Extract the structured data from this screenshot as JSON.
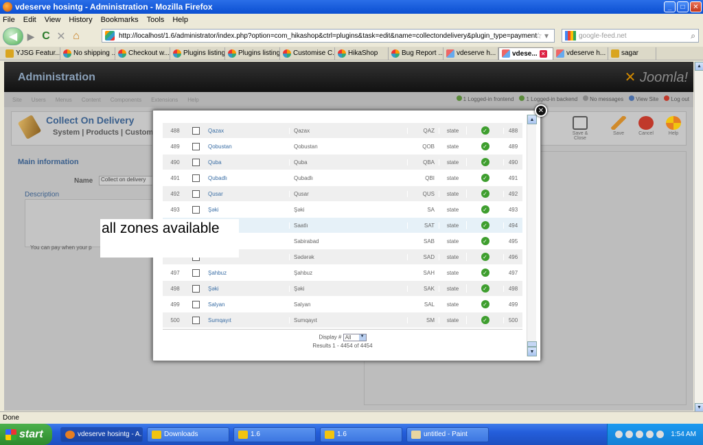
{
  "window": {
    "title": "vdeserve hosintg - Administration - Mozilla Firefox",
    "min": "_",
    "max": "□",
    "close": "✕"
  },
  "menubar": [
    "File",
    "Edit",
    "View",
    "History",
    "Bookmarks",
    "Tools",
    "Help"
  ],
  "nav": {
    "back": "◀",
    "forward": "▶",
    "reload": "C",
    "stop": "✕",
    "home": "⌂",
    "url": "http://localhost/1.6/administrator/index.php?option=com_hikashop&ctrl=plugins&task=edit&name=collectondelivery&plugin_type=payment",
    "star": "☆ ▾",
    "search_placeholder": "google-feed.net",
    "search_icon": "⌕"
  },
  "tabs": [
    {
      "label": "YJSG Featur...",
      "icon": "plain"
    },
    {
      "label": "No shipping ...",
      "icon": "joomla"
    },
    {
      "label": "Checkout w...",
      "icon": "joomla"
    },
    {
      "label": "Plugins listing",
      "icon": "joomla"
    },
    {
      "label": "Plugins listing",
      "icon": "joomla"
    },
    {
      "label": "Customise C...",
      "icon": "joomla"
    },
    {
      "label": "HikaShop",
      "icon": "joomla"
    },
    {
      "label": "Bug Report ...",
      "icon": "joomla"
    },
    {
      "label": "vdeserve h...",
      "icon": "x"
    },
    {
      "label": "vdese...",
      "icon": "x",
      "active": true
    },
    {
      "label": "vdeserve h...",
      "icon": "x"
    },
    {
      "label": "sagar",
      "icon": "plain"
    }
  ],
  "admin": {
    "title": "Administration",
    "logo": "Joomla!",
    "menu": [
      "Site",
      "Users",
      "Menus",
      "Content",
      "Components",
      "Extensions",
      "Help"
    ],
    "status": [
      "1 Logged-in frontend",
      "1 Logged-in backend",
      "No messages",
      "View Site",
      "Log out"
    ],
    "page_title": "Collect On Delivery",
    "subnav": "System | Products | Customers",
    "toolbar": [
      "Save & Close",
      "Save",
      "Cancel",
      "Help"
    ],
    "main_info": "Main information",
    "name_label": "Name",
    "name_value": "Collect on delivery",
    "description_label": "Description",
    "editor_text": "You can pay when your p"
  },
  "zones": [
    {
      "num": "488",
      "name": "Qazax",
      "name2": "Qazax",
      "code": "QAZ",
      "type": "state",
      "id": "488"
    },
    {
      "num": "489",
      "name": "Qobustan",
      "name2": "Qobustan",
      "code": "QOB",
      "type": "state",
      "id": "489"
    },
    {
      "num": "490",
      "name": "Quba",
      "name2": "Quba",
      "code": "QBA",
      "type": "state",
      "id": "490"
    },
    {
      "num": "491",
      "name": "Qubadlı",
      "name2": "Qubadlı",
      "code": "QBI",
      "type": "state",
      "id": "491"
    },
    {
      "num": "492",
      "name": "Qusar",
      "name2": "Qusar",
      "code": "QUS",
      "type": "state",
      "id": "492"
    },
    {
      "num": "493",
      "name": "Şəki",
      "name2": "Şəki",
      "code": "SA",
      "type": "state",
      "id": "493"
    },
    {
      "num": "",
      "name": "",
      "name2": "Saatlı",
      "code": "SAT",
      "type": "state",
      "id": "494"
    },
    {
      "num": "",
      "name": "",
      "name2": "Sabirabad",
      "code": "SAB",
      "type": "state",
      "id": "495"
    },
    {
      "num": "",
      "name": "",
      "name2": "Sədərək",
      "code": "SAD",
      "type": "state",
      "id": "496"
    },
    {
      "num": "497",
      "name": "Şahbuz",
      "name2": "Şahbuz",
      "code": "SAH",
      "type": "state",
      "id": "497"
    },
    {
      "num": "498",
      "name": "Şəki",
      "name2": "Şəki",
      "code": "SAK",
      "type": "state",
      "id": "498"
    },
    {
      "num": "499",
      "name": "Salyan",
      "name2": "Salyan",
      "code": "SAL",
      "type": "state",
      "id": "499"
    },
    {
      "num": "500",
      "name": "Sumqayıt",
      "name2": "Sumqayıt",
      "code": "SM",
      "type": "state",
      "id": "500"
    }
  ],
  "modal": {
    "close": "✕",
    "display_label": "Display #",
    "display_value": "All",
    "results": "Results 1 - 4454 of 4454"
  },
  "annotation": "all zones available",
  "statusbar": "Done",
  "taskbar": {
    "start": "start",
    "tasks": [
      "vdeserve hosintg - A...",
      "Downloads",
      "1.6",
      "1.6",
      "untitled - Paint"
    ],
    "clock": "1:54 AM"
  },
  "colors": {
    "accent": "#3a6ea5",
    "publish_green": "#3e9e2e",
    "taskbar_blue": "#245edb"
  }
}
